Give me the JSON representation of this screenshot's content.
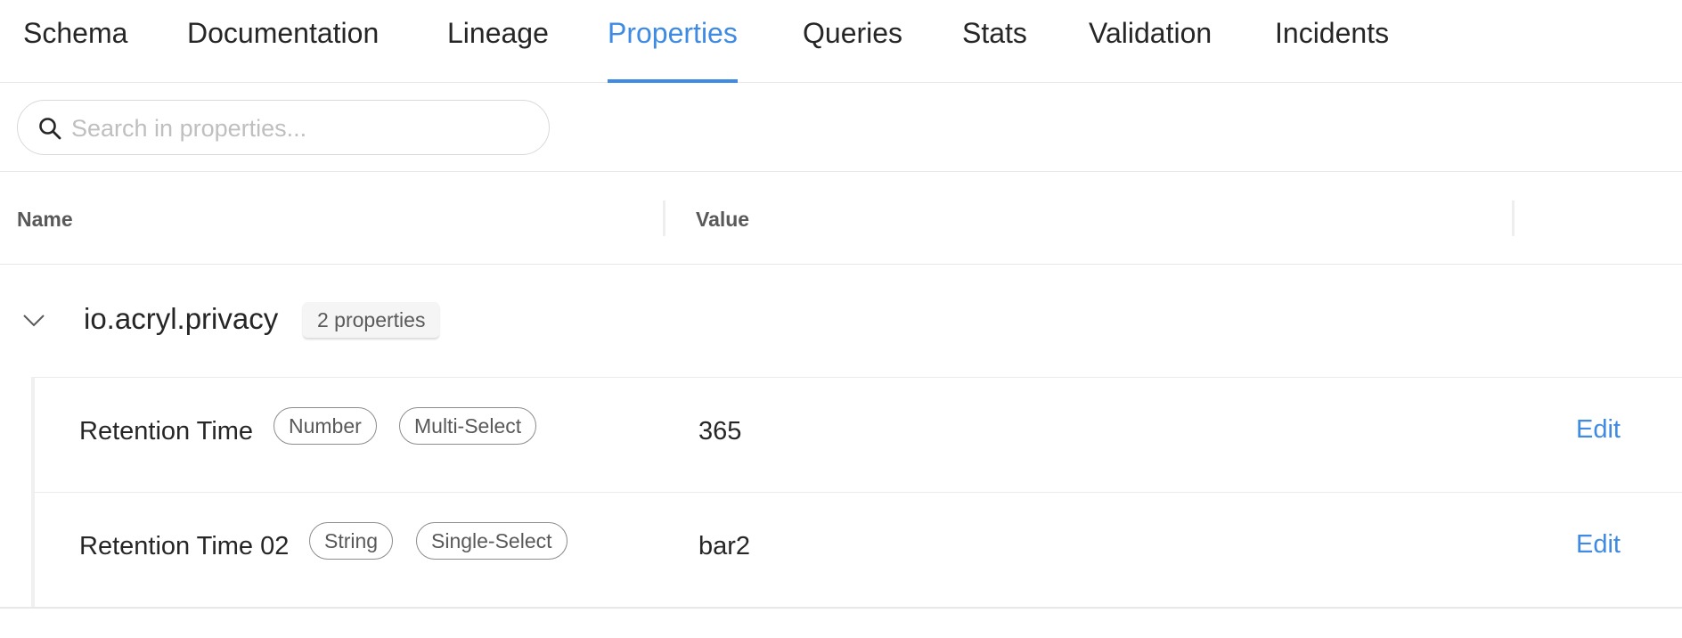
{
  "tabs": [
    {
      "label": "Schema",
      "active": false
    },
    {
      "label": "Documentation",
      "active": false
    },
    {
      "label": "Lineage",
      "active": false
    },
    {
      "label": "Properties",
      "active": true
    },
    {
      "label": "Queries",
      "active": false
    },
    {
      "label": "Stats",
      "active": false
    },
    {
      "label": "Validation",
      "active": false
    },
    {
      "label": "Incidents",
      "active": false
    }
  ],
  "search": {
    "placeholder": "Search in properties...",
    "value": ""
  },
  "table": {
    "columns": [
      "Name",
      "Value"
    ]
  },
  "group": {
    "name": "io.acryl.privacy",
    "count_label": "2 properties",
    "expanded": true
  },
  "properties": [
    {
      "name": "Retention Time",
      "type_tag": "Number",
      "cardinality_tag": "Multi-Select",
      "value": "365",
      "action_label": "Edit"
    },
    {
      "name": "Retention Time 02",
      "type_tag": "String",
      "cardinality_tag": "Single-Select",
      "value": "bar2",
      "action_label": "Edit"
    }
  ],
  "colors": {
    "accent": "#3f8ae2",
    "text": "#262626",
    "muted": "#595959",
    "border": "#e8e8e8"
  }
}
